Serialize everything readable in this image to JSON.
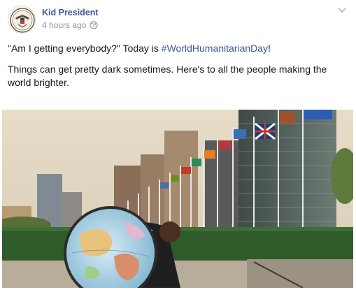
{
  "post": {
    "author": "Kid President",
    "time": "4 hours ago",
    "privacy_icon": "globe-icon",
    "menu_icon": "chevron-down-icon",
    "line1_prefix": "\"Am I getting everybody?\" Today is ",
    "hashtag": "#WorldHumanitarianDay",
    "line1_suffix": "!",
    "line2": "Things can get pretty dark sometimes. Here's to all the people making the world brighter."
  },
  "colors": {
    "link": "#3b5998",
    "meta": "#90949c",
    "text": "#141823"
  }
}
